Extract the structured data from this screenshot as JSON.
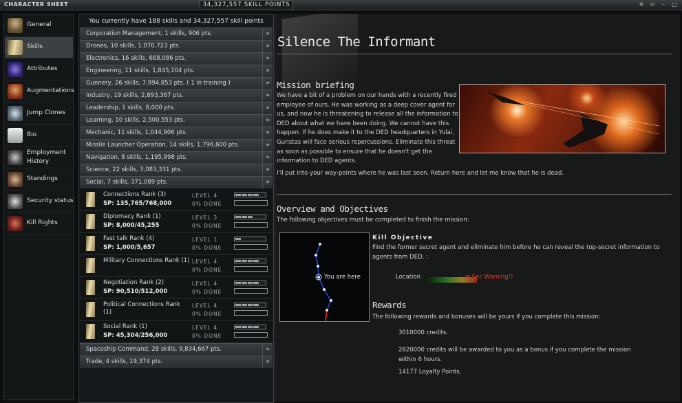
{
  "window": {
    "title": "CHARACTER SHEET",
    "skill_points_header": "34,327,557 SKILL POINTS",
    "buttons": [
      "✲",
      "⊙",
      "–",
      "□"
    ]
  },
  "nav": [
    {
      "label": "General",
      "icon": "general-icon",
      "active": false
    },
    {
      "label": "Skills",
      "icon": "skillbook-icon",
      "active": true
    },
    {
      "label": "Attributes",
      "icon": "attributes-icon",
      "active": false
    },
    {
      "label": "Augmentations",
      "icon": "augmentations-icon",
      "active": false
    },
    {
      "label": "Jump Clones",
      "icon": "jump-clone-icon",
      "active": false
    },
    {
      "label": "Bio",
      "icon": "bio-icon",
      "active": false
    },
    {
      "label": "Employment History",
      "icon": "employment-icon",
      "active": false
    },
    {
      "label": "Standings",
      "icon": "standings-icon",
      "active": false
    },
    {
      "label": "Security status",
      "icon": "security-icon",
      "active": false
    },
    {
      "label": "Kill Rights",
      "icon": "kill-rights-icon",
      "active": false
    }
  ],
  "skills": {
    "summary": "You currently have 188 skills and 34,327,557 skill points",
    "groups_top": [
      "Corporation Management, 1 skills, 906 pts.",
      "Drones, 10 skills, 1,070,723 pts.",
      "Electronics, 16 skills, 668,086 pts.",
      "Engineering, 11 skills, 1,845,104 pts.",
      "Gunnery, 26 skills, 7,994,853 pts. ( 1 in training )",
      "Industry, 19 skills, 2,893,367 pts.",
      "Leadership, 1 skills, 8,000 pts.",
      "Learning, 10 skills, 2,500,553 pts.",
      "Mechanic, 11 skills, 1,044,906 pts.",
      "Missile Launcher Operation, 14 skills, 1,796,600 pts.",
      "Navigation, 8 skills, 1,195,998 pts.",
      "Science, 22 skills, 3,083,331 pts."
    ],
    "expanded_group": "Social, 7 skills, 371,089 pts.",
    "expanded_skills": [
      {
        "name": "Connections Rank (3)",
        "sp": "SP:  135,765/768,000",
        "level": "LEVEL 4",
        "done": "0% DONE",
        "level_value": 4
      },
      {
        "name": "Diplomacy Rank (1)",
        "sp": "SP:  8,000/45,255",
        "level": "LEVEL 3",
        "done": "0% DONE",
        "level_value": 3
      },
      {
        "name": "Fast talk Rank (4)",
        "sp": "SP:  1,000/5,657",
        "level": "LEVEL 1",
        "done": "0% DONE",
        "level_value": 1
      },
      {
        "name": "Military Connections Rank (1)",
        "sp": "",
        "level": "LEVEL 4",
        "done": "0% DONE",
        "level_value": 4
      },
      {
        "name": "Negotiation Rank (2)",
        "sp": "SP:  90,510/512,000",
        "level": "LEVEL 4",
        "done": "0% DONE",
        "level_value": 4
      },
      {
        "name": "Political Connections Rank (1)",
        "sp": "",
        "level": "LEVEL 4",
        "done": "0% DONE",
        "level_value": 4
      },
      {
        "name": "Social Rank (1)",
        "sp": "SP:  45,304/256,000",
        "level": "LEVEL 4",
        "done": "0% DONE",
        "level_value": 4
      }
    ],
    "groups_bottom": [
      "Spaceship Command, 28 skills, 9,834,667 pts.",
      "Trade, 4 skills, 19,374 pts."
    ],
    "collapse_glyph": "«",
    "expand_glyph": "»"
  },
  "mission": {
    "title": "Silence The Informant",
    "briefing_heading": "Mission briefing",
    "briefing_text": "We have a bit of a problem on our hands with a recently fired employee of ours. He was working as a deep cover agent for us, and now he is threatening to release all the information to DED about what we have been doing. We cannot have this happen. If he does make it to the DED headquarters in Yulai, Guristas will face serious repercussions. Eliminate this threat as soon as possible to ensure that he doesn't get the information to DED agents.",
    "briefing_text2": "I'll put into your way-points where he was last seen. Return here and let me know that he is dead.",
    "objectives_heading": "Overview and Objectives",
    "objectives_intro": "The following objectives must be completed to finish the mission:",
    "you_are_here": "You are here",
    "kill_heading": "Kill Objective",
    "kill_text": "Find the former secret agent and eliminate him before he can reveal the top-secret information to agents from DED. :",
    "location_label": "Location",
    "location_warning": "w Sec Warning!)",
    "rewards_heading": "Rewards",
    "rewards_intro": "The following rewards and bonuses will be yours if you complete this mission:",
    "reward_credits": "3010000 credits.",
    "bonus_text": "2620000 credits will be awarded to you as a bonus if you complete the mission within 6 hours.",
    "loyalty_points": "14177 Loyalty Points."
  },
  "colors": {
    "accent": "#d8dcde",
    "warning": "#e03a2a",
    "route_blue": "#2a4adf"
  }
}
